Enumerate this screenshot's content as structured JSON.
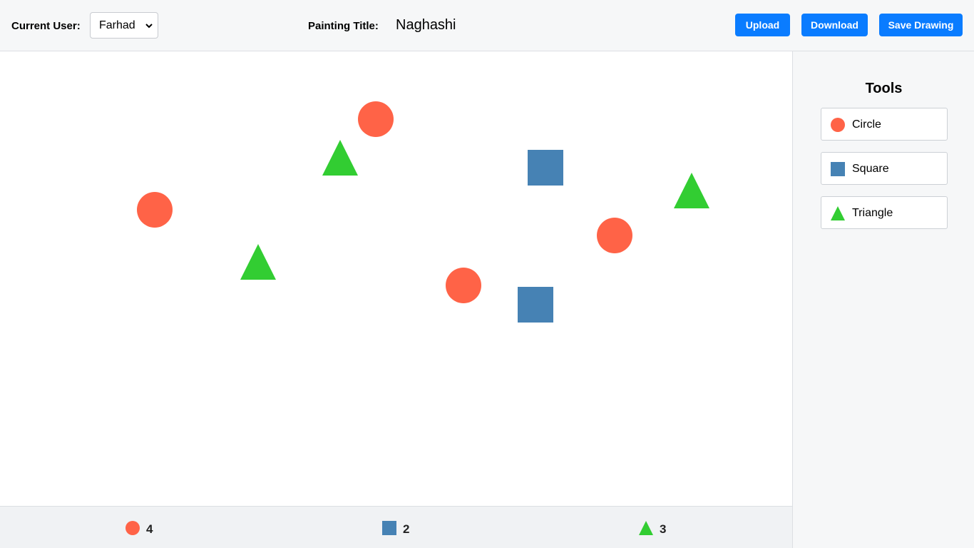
{
  "header": {
    "user_label": "Current User:",
    "user_selected": "Farhad",
    "title_label": "Painting Title:",
    "title_value": "Naghashi",
    "upload_label": "Upload",
    "download_label": "Download",
    "save_label": "Save Drawing"
  },
  "colors": {
    "circle": "#ff6347",
    "square": "#4682b4",
    "triangle": "#32cd32",
    "button": "#0a7cff"
  },
  "tools": {
    "heading": "Tools",
    "items": [
      {
        "label": "Circle",
        "icon": "circle-icon"
      },
      {
        "label": "Square",
        "icon": "square-icon"
      },
      {
        "label": "Triangle",
        "icon": "triangle-icon"
      }
    ]
  },
  "counts": {
    "circle": "4",
    "square": "2",
    "triangle": "3"
  }
}
